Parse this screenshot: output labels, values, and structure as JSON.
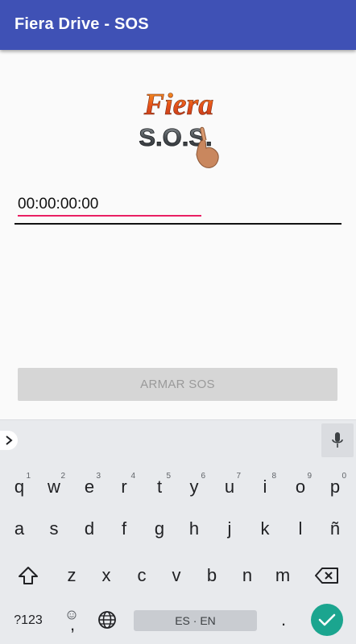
{
  "app": {
    "title": "Fiera Drive - SOS"
  },
  "logo": {
    "line1": "Fiera",
    "line2": "S.O.S."
  },
  "timer": {
    "value": "00:00:00:00"
  },
  "actions": {
    "arm_label": "ARMAR SOS"
  },
  "keyboard": {
    "row1": [
      {
        "k": "q",
        "h": "1"
      },
      {
        "k": "w",
        "h": "2"
      },
      {
        "k": "e",
        "h": "3"
      },
      {
        "k": "r",
        "h": "4"
      },
      {
        "k": "t",
        "h": "5"
      },
      {
        "k": "y",
        "h": "6"
      },
      {
        "k": "u",
        "h": "7"
      },
      {
        "k": "i",
        "h": "8"
      },
      {
        "k": "o",
        "h": "9"
      },
      {
        "k": "p",
        "h": "0"
      }
    ],
    "row2": [
      "a",
      "s",
      "d",
      "f",
      "g",
      "h",
      "j",
      "k",
      "l",
      "ñ"
    ],
    "row3": [
      "z",
      "x",
      "c",
      "v",
      "b",
      "n",
      "m"
    ],
    "symbols_label": "?123",
    "comma": ",",
    "period": ".",
    "space_label": "ES · EN",
    "icons": [
      "expand-icon",
      "mic-icon",
      "shift-icon",
      "backspace-icon",
      "emoji-icon",
      "globe-icon",
      "check-icon"
    ],
    "accent_color": "#1ba58f"
  }
}
